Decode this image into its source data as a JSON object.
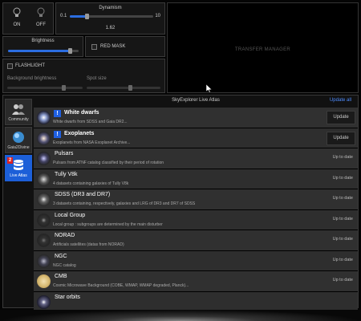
{
  "top": {
    "on_label": "ON",
    "off_label": "OFF",
    "dynamism": {
      "title": "Dynamism",
      "min": "0.1",
      "max": "10",
      "value": "1.62",
      "level": 0.2
    },
    "brightness": {
      "title": "Brightness",
      "level": 0.88
    },
    "red_mask": {
      "label": "RED MASK",
      "checked": false
    },
    "flashlight": {
      "label": "FLASHLIGHT",
      "checked": false,
      "background_label": "Background brightness",
      "spot_label": "Spot size"
    },
    "transfer_manager": "TRANSFER MANAGER"
  },
  "atlas": {
    "title": "SkyExplorer Live Atlas",
    "update_all": "Update all",
    "sidebar": [
      {
        "label": "Community",
        "icon": "community-icon"
      },
      {
        "label": "Gaia2Divine",
        "icon": "gaia-icon"
      },
      {
        "label": "Live Atlas",
        "icon": "database-icon",
        "badge": "2",
        "active": true
      }
    ],
    "items": [
      {
        "title": "White dwarfs",
        "desc": "White dwarfs from SDSS and Gaia DR2...",
        "status": "Update",
        "needs_update": true,
        "icon": "white-dwarf-icon"
      },
      {
        "title": "Exoplanets",
        "desc": "Exoplanets from NASA Exoplanet Archive...",
        "status": "Update",
        "needs_update": true,
        "icon": "exoplanet-icon"
      },
      {
        "title": "Pulsars",
        "desc": "Pulsars from ATNF catalog classified by their period of rotation",
        "status": "Up to date",
        "needs_update": false,
        "icon": "pulsar-icon"
      },
      {
        "title": "Tully V8k",
        "desc": "4 datasets containing galaxies of Tully V8k",
        "status": "Up to date",
        "needs_update": false,
        "icon": "galaxy-icon"
      },
      {
        "title": "SDSS (DR3 and DR7)",
        "desc": "3 datasets containing, respectively, galaxies and LRG of DR3 and DR7 of SDSS",
        "status": "Up to date",
        "needs_update": false,
        "icon": "sdss-icon"
      },
      {
        "title": "Local Group",
        "desc": "Local group : subgroups are determined by the main disturber",
        "status": "Up to date",
        "needs_update": false,
        "icon": "local-group-icon"
      },
      {
        "title": "NORAD",
        "desc": "Artificials satellites (datas from NORAD)",
        "status": "Up to date",
        "needs_update": false,
        "icon": "satellite-icon"
      },
      {
        "title": "NGC",
        "desc": "NGC catalog",
        "status": "Up to date",
        "needs_update": false,
        "icon": "ngc-icon"
      },
      {
        "title": "CMB",
        "desc": "Cosmic Microwave Background (COBE, WMAP, WMAP degraded, Planck)...",
        "status": "Up to date",
        "needs_update": false,
        "icon": "cmb-icon"
      },
      {
        "title": "Star orbits",
        "desc": "",
        "status": "",
        "needs_update": false,
        "icon": "star-orbits-icon"
      }
    ]
  }
}
